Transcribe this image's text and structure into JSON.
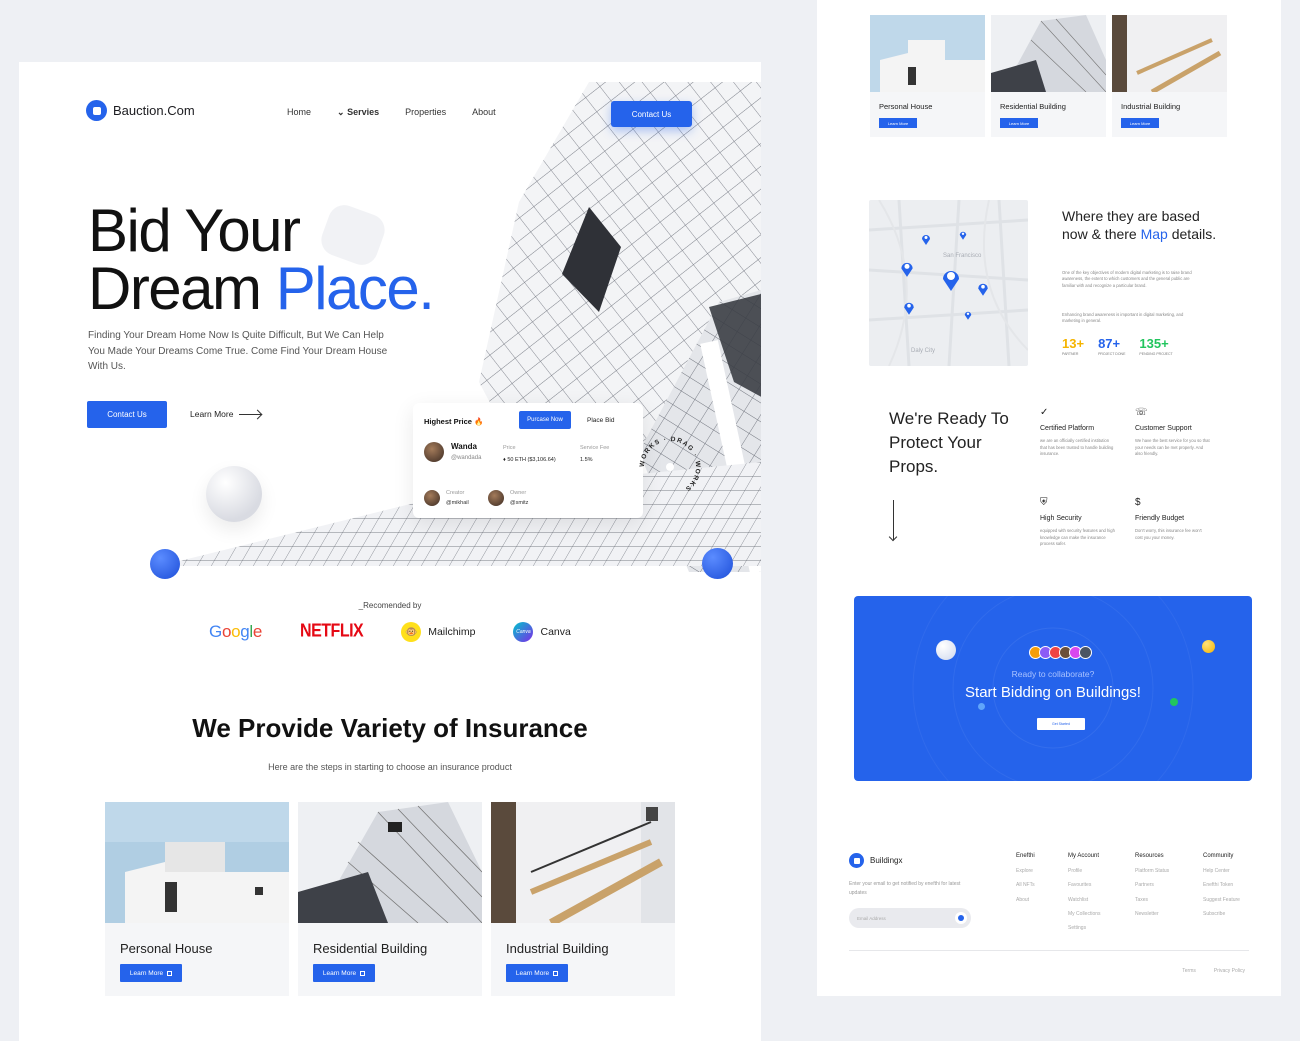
{
  "brand": {
    "name": "Bauction.Com"
  },
  "nav": {
    "home": "Home",
    "services": "Servies",
    "properties": "Properties",
    "about": "About",
    "contact": "Contact Us"
  },
  "hero": {
    "title_line1": "Bid Your",
    "title_line2_dark": "Dream ",
    "title_line2_blue": "Place.",
    "subtitle": "Finding Your Dream Home Now Is Quite Difficult, But We Can Help You  Made Your Dreams Come True. Come Find Your Dream House With Us.",
    "contact_button": "Contact Us",
    "learn_more": "Learn More"
  },
  "bid_card": {
    "highest_price": "Highest Price",
    "purchase_button": "Purcase Now",
    "place_bid": "Place Bid",
    "user_name": "Wanda",
    "user_handle": "@wandada",
    "price_label": "Price",
    "price_value": "50 ETH ($3,106.64)",
    "fee_label": "Service Fee",
    "fee_value": "1.5%",
    "creator_label": "Creator",
    "creator_handle": "@mikhail",
    "owner_label": "Owner",
    "owner_handle": "@smitz",
    "badge_text": "WORKS · DRAG · WORKS"
  },
  "recommended": {
    "label": "_Recomended by",
    "brands": {
      "google": "Google",
      "netflix": "NETFLIX",
      "mailchimp": "Mailchimp",
      "canva": "Canva",
      "canva_icon": "Canva"
    }
  },
  "insurance": {
    "title": "We Provide Variety of Insurance",
    "subtitle": "Here are the steps in starting to choose an insurance product",
    "cards": [
      {
        "title": "Personal House",
        "button": "Learn More"
      },
      {
        "title": "Residential Building",
        "button": "Learn More"
      },
      {
        "title": "Industrial Building",
        "button": "Learn More"
      }
    ]
  },
  "map_section": {
    "title_part1": "Where they are based now & there ",
    "title_blue": "Map",
    "title_part2": " details.",
    "para1": "One of the key objectives of modern digital marketing is to raise brand awareness, the extent to which customers and the general public are familiar with and recognize a particular brand.",
    "para2": "Enhancing brand awareness is important in digital marketing, and marketing in general.",
    "map_labels": {
      "city": "San Francisco",
      "daly": "Daly City"
    },
    "stats": [
      {
        "value": "13+",
        "label": "PARTNER",
        "color": "#f5b400"
      },
      {
        "value": "87+",
        "label": "PROJECT DONE",
        "color": "#2563eb"
      },
      {
        "value": "135+",
        "label": "PENDING PROJECT",
        "color": "#22c55e"
      }
    ]
  },
  "ready": {
    "title": "We're Ready To Protect Your Props.",
    "features": [
      {
        "title": "Certified Platform",
        "desc": "we are an officially certified institution that has been trusted to handle building insurance."
      },
      {
        "title": "Customer Support",
        "desc": "We have the best service for you so that your needs can be met properly. And also friendly."
      },
      {
        "title": "High Security",
        "desc": "equipped with security features and high knowledge can make the insurance process safer."
      },
      {
        "title": "Friendly Budget",
        "desc": "Don't worry, this insurance fee won't cost you your money."
      }
    ]
  },
  "cta": {
    "question": "Ready to collaborate?",
    "headline": "Start Bidding on Buildings!",
    "button": "Get Started"
  },
  "footer": {
    "brand": "Buildingx",
    "desc": "Enter your email to get notified by enefthi for latest updates",
    "email_placeholder": "Email Address",
    "columns": [
      {
        "heading": "Enefthi",
        "items": [
          "Explore",
          "All NFTs",
          "About"
        ]
      },
      {
        "heading": "My Account",
        "items": [
          "Profile",
          "Favourites",
          "Watchlist",
          "My Collections",
          "Settings"
        ]
      },
      {
        "heading": "Resources",
        "items": [
          "Platform Status",
          "Partners",
          "Taxes",
          "Newsletter"
        ]
      },
      {
        "heading": "Community",
        "items": [
          "Help Center",
          "Enefthi Token",
          "Suggest Feature",
          "Subscribe"
        ]
      }
    ],
    "terms": "Terms",
    "privacy": "Privacy Policy"
  },
  "colors": {
    "accent": "#2563eb"
  }
}
